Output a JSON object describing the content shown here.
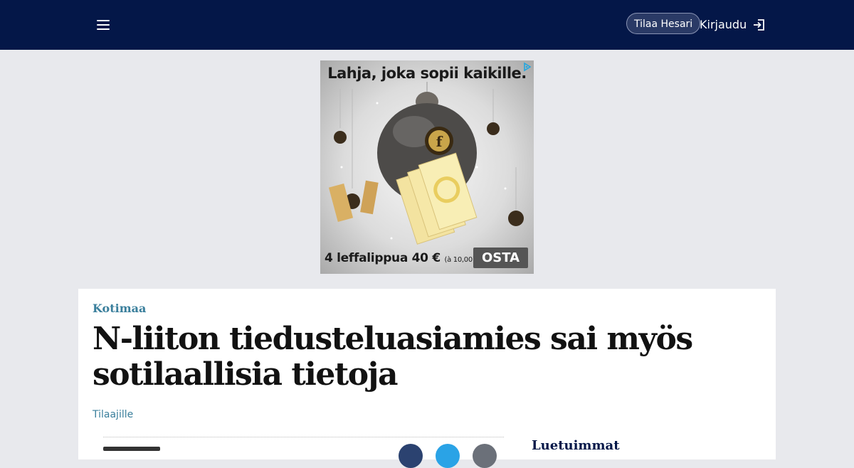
{
  "header": {
    "subscribe_label": "Tilaa Hesari",
    "login_label": "Kirjaudu"
  },
  "ad": {
    "headline": "Lahja, joka sopii kaikille.",
    "offer": "4 leffalippua 40 €",
    "offer_note": "(à 10,00)",
    "cta_label": "OSTA",
    "colors": {
      "cta": "#555555",
      "badge": "#22a7e0"
    }
  },
  "article": {
    "section": "Kotimaa",
    "headline": "N-liiton tiedusteluasiamies sai myös sotilaallisia tietoja",
    "access_label": "Tilaajille"
  },
  "sidebar": {
    "popular_title": "Luetuimmat"
  },
  "colors": {
    "header_bg": "#041748",
    "page_bg": "#e8e9ed",
    "accent_teal": "#3a7f9c"
  }
}
